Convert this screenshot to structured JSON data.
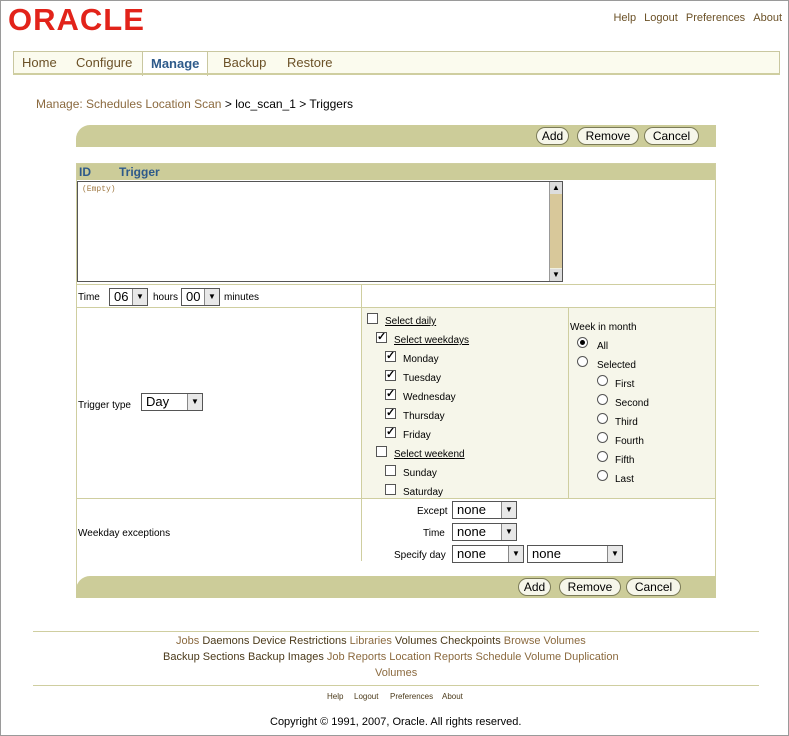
{
  "brand": {
    "logo_text": "ORACLE",
    "logo_color": "#e2231a"
  },
  "global_links": [
    "Help",
    "Logout",
    "Preferences",
    "About"
  ],
  "tabs": [
    "Home",
    "Configure",
    "Manage",
    "Backup",
    "Restore"
  ],
  "active_tab": "Manage",
  "breadcrumb": {
    "part1": "Manage: Schedules",
    "part2": "Location Scan",
    "sep1": ">",
    "part3": "loc_scan_1",
    "sep2": ">",
    "current": "Triggers"
  },
  "buttons": {
    "add": "Add",
    "remove": "Remove",
    "cancel": "Cancel"
  },
  "table": {
    "col_id": "ID",
    "col_trigger": "Trigger",
    "empty_text": "(Empty)"
  },
  "time": {
    "label": "Time",
    "hours_value": "06",
    "hours_label": "hours",
    "minutes_value": "00",
    "minutes_label": "minutes"
  },
  "trigger_type": {
    "label": "Trigger type",
    "value": "Day"
  },
  "days": {
    "select_daily": "Select daily",
    "select_weekdays": "Select weekdays",
    "weekdays": [
      "Monday",
      "Tuesday",
      "Wednesday",
      "Thursday",
      "Friday"
    ],
    "select_weekend": "Select weekend",
    "weekend": [
      "Sunday",
      "Saturday"
    ]
  },
  "week_in_month": {
    "label": "Week in month",
    "all": "All",
    "selected": "Selected",
    "options": [
      "First",
      "Second",
      "Third",
      "Fourth",
      "Fifth",
      "Last"
    ]
  },
  "weekday_exceptions": {
    "label": "Weekday exceptions",
    "except_label": "Except",
    "except_value": "none",
    "time_label": "Time",
    "time_value": "none",
    "specify_day_label": "Specify day",
    "specify_day_value1": "none",
    "specify_day_value2": "none"
  },
  "footer": {
    "row1": [
      "Jobs",
      "Daemons",
      "Device Restrictions",
      "Libraries",
      "Volumes",
      "Checkpoints",
      "Browse Volumes"
    ],
    "row2": [
      "Backup Sections",
      "Backup Images",
      "Job Reports",
      "Location Reports",
      "Schedule Volume Duplication"
    ],
    "row3": [
      "Volumes"
    ],
    "small_links": [
      "Help",
      "Logout",
      "Preferences",
      "About"
    ],
    "copyright": "Copyright © 1991, 2007, Oracle. All rights reserved."
  }
}
